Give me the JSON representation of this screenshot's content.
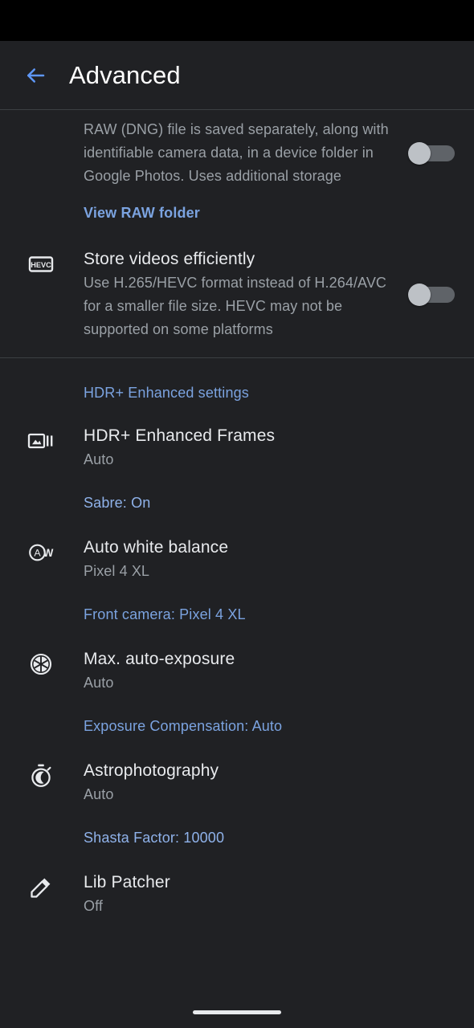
{
  "app": {
    "title": "Advanced",
    "back_icon": "arrow-left-icon"
  },
  "colors": {
    "background": "#202124",
    "status_bar": "#000000",
    "link_blue": "#7ba3e0",
    "link_blue_light": "#8fb2ea",
    "title_text": "#e8eaed",
    "secondary_text": "#9aa0a6",
    "divider": "#3c4043",
    "toggle_track_off": "#5f6368",
    "toggle_thumb_off": "#bdc1c6"
  },
  "sections": [
    {
      "id": "raw-dng",
      "rows": [
        {
          "type": "setting-with-toggle",
          "name": "raw-dng-setting",
          "icon": "",
          "title": "",
          "description": "RAW (DNG) file is saved separately, along with identifiable camera data, in a device folder in Google Photos. Uses additional storage",
          "toggle": {
            "name": "raw-dng-toggle",
            "state": "off"
          }
        },
        {
          "type": "link",
          "name": "view-raw-folder-link",
          "label": "View RAW folder",
          "style": "bold"
        }
      ]
    },
    {
      "id": "store-videos",
      "rows": [
        {
          "type": "setting-with-toggle",
          "name": "store-videos-efficiently-setting",
          "icon": "hevc-icon",
          "title": "Store videos efficiently",
          "description": "Use H.265/HEVC format instead of H.264/AVC for a smaller file size. HEVC may not be supported on some platforms",
          "toggle": {
            "name": "store-videos-efficiently-toggle",
            "state": "off"
          }
        }
      ]
    },
    {
      "id": "hdr-plus",
      "rows": [
        {
          "type": "link",
          "name": "hdr-plus-enhanced-settings-link",
          "label": "HDR+ Enhanced settings",
          "style": "normal"
        },
        {
          "type": "setting",
          "name": "hdr-plus-enhanced-frames-setting",
          "icon": "photo-burst-icon",
          "title": "HDR+ Enhanced Frames",
          "value": "Auto"
        },
        {
          "type": "link",
          "name": "sabre-link",
          "label": "Sabre: On",
          "style": "light"
        },
        {
          "type": "setting",
          "name": "auto-white-balance-setting",
          "icon": "auto-white-balance-icon",
          "title": "Auto white balance",
          "value": "Pixel 4 XL"
        },
        {
          "type": "link",
          "name": "front-camera-link",
          "label": "Front camera: Pixel 4 XL",
          "style": "normal"
        },
        {
          "type": "setting",
          "name": "max-auto-exposure-setting",
          "icon": "aperture-icon",
          "title": "Max. auto-exposure",
          "value": "Auto"
        },
        {
          "type": "link",
          "name": "exposure-compensation-link",
          "label": "Exposure Compensation: Auto",
          "style": "normal"
        },
        {
          "type": "setting",
          "name": "astrophotography-setting",
          "icon": "stopwatch-moon-icon",
          "title": "Astrophotography",
          "value": "Auto"
        },
        {
          "type": "link",
          "name": "shasta-factor-link",
          "label": "Shasta Factor: 10000",
          "style": "light"
        },
        {
          "type": "setting",
          "name": "lib-patcher-setting",
          "icon": "eyedropper-icon",
          "title": "Lib Patcher",
          "value": "Off"
        }
      ]
    }
  ],
  "icons": {
    "hevc_label": "HEVC",
    "awb_letter_a": "A",
    "awb_letter_w": "W"
  }
}
